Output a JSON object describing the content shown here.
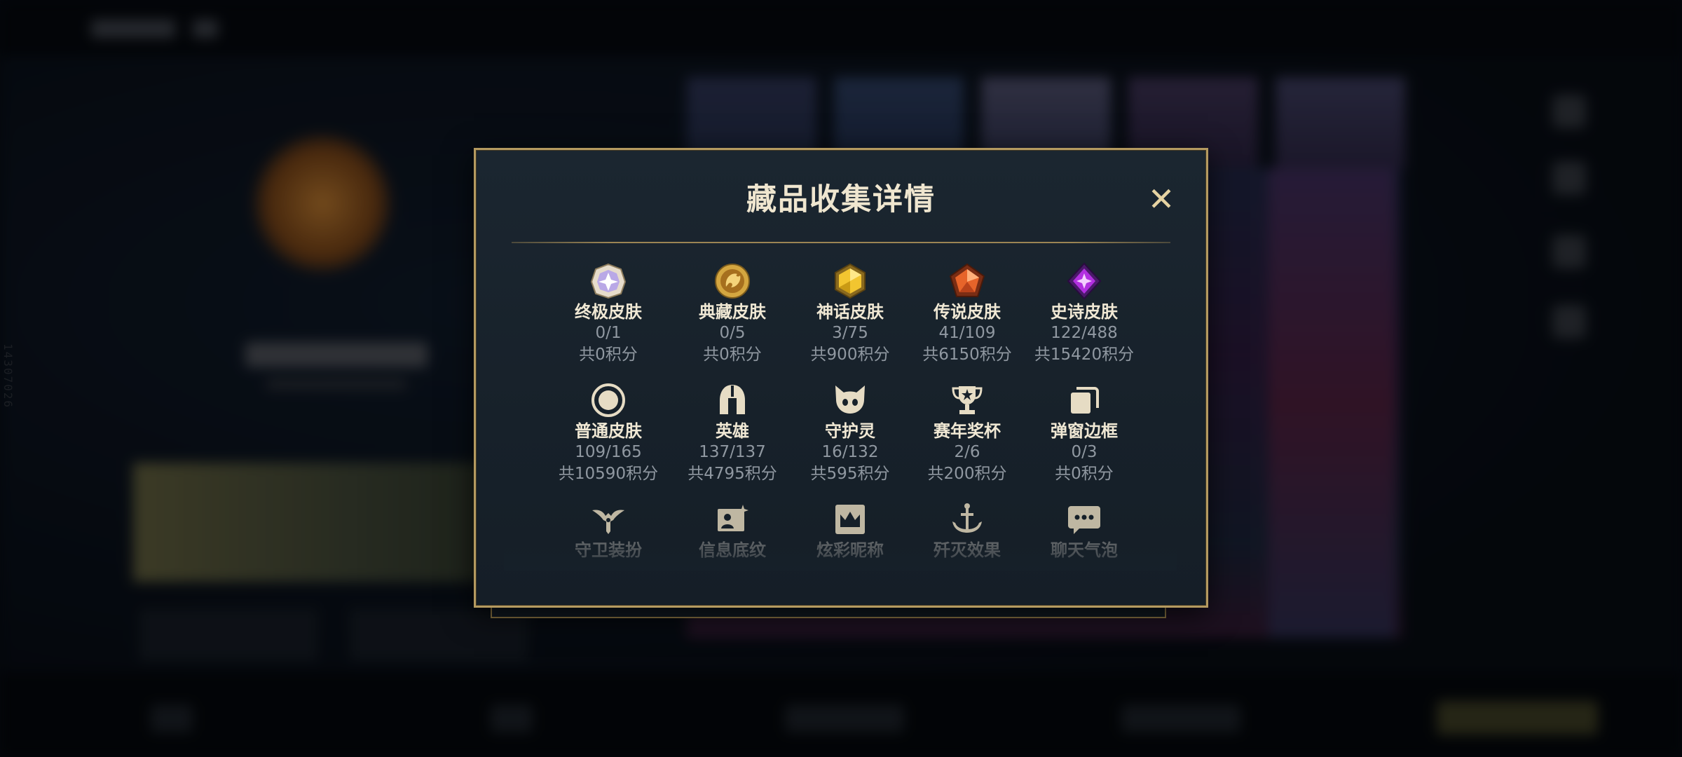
{
  "background": {
    "side_id": "14307026"
  },
  "modal": {
    "title": "藏品收集详情",
    "close_label": "✕",
    "rows": [
      [
        {
          "name": "终极皮肤",
          "count": "0/1",
          "points": "共0积分",
          "icon": "ultimate-skin-icon"
        },
        {
          "name": "典藏皮肤",
          "count": "0/5",
          "points": "共0积分",
          "icon": "prestige-skin-icon"
        },
        {
          "name": "神话皮肤",
          "count": "3/75",
          "points": "共900积分",
          "icon": "mythic-skin-icon"
        },
        {
          "name": "传说皮肤",
          "count": "41/109",
          "points": "共6150积分",
          "icon": "legendary-skin-icon"
        },
        {
          "name": "史诗皮肤",
          "count": "122/488",
          "points": "共15420积分",
          "icon": "epic-skin-icon"
        }
      ],
      [
        {
          "name": "普通皮肤",
          "count": "109/165",
          "points": "共10590积分",
          "icon": "standard-skin-icon"
        },
        {
          "name": "英雄",
          "count": "137/137",
          "points": "共4795积分",
          "icon": "champion-helmet-icon"
        },
        {
          "name": "守护灵",
          "count": "16/132",
          "points": "共595积分",
          "icon": "guardian-spirit-icon"
        },
        {
          "name": "赛年奖杯",
          "count": "2/6",
          "points": "共200积分",
          "icon": "trophy-icon"
        },
        {
          "name": "弹窗边框",
          "count": "0/3",
          "points": "共0积分",
          "icon": "popup-frame-icon"
        }
      ],
      [
        {
          "name": "守卫装扮",
          "icon": "ward-skin-icon"
        },
        {
          "name": "信息底纹",
          "icon": "info-card-icon"
        },
        {
          "name": "炫彩昵称",
          "icon": "crown-nameplate-icon"
        },
        {
          "name": "歼灭效果",
          "icon": "anchor-effect-icon"
        },
        {
          "name": "聊天气泡",
          "icon": "chat-bubble-icon"
        }
      ]
    ]
  },
  "colors": {
    "gold_border": "#b49a60",
    "title_text": "#efe6cf",
    "muted_text": "#9098a1"
  }
}
